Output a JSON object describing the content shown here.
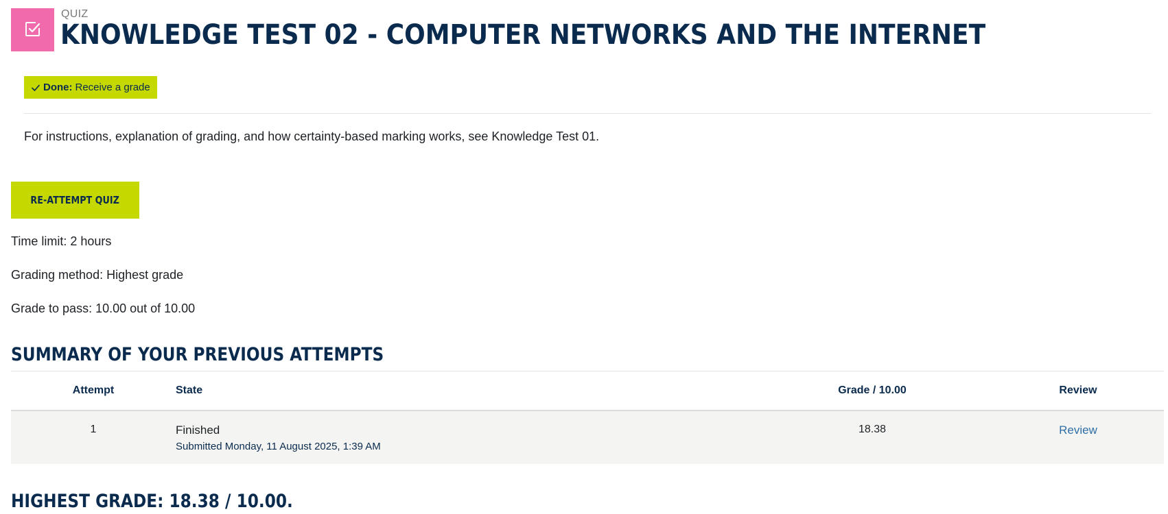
{
  "header": {
    "module_type": "QUIZ",
    "title": "KNOWLEDGE TEST 02 - COMPUTER NETWORKS AND THE INTERNET",
    "icon": "quiz-checkbox-icon",
    "icon_bg_color": "#f06aac"
  },
  "completion": {
    "status_label": "Done:",
    "requirement": "Receive a grade",
    "badge_color": "#c5d800"
  },
  "intro": "For instructions, explanation of grading, and how certainty-based marking works, see Knowledge Test 01.",
  "actions": {
    "reattempt_label": "RE-ATTEMPT QUIZ"
  },
  "quiz_info": {
    "time_limit": "Time limit: 2 hours",
    "grading_method": "Grading method: Highest grade",
    "grade_to_pass": "Grade to pass: 10.00 out of 10.00"
  },
  "summary": {
    "heading": "SUMMARY OF YOUR PREVIOUS ATTEMPTS",
    "columns": [
      "Attempt",
      "State",
      "Grade / 10.00",
      "Review"
    ],
    "rows": [
      {
        "attempt": "1",
        "state": "Finished",
        "submitted": "Submitted Monday, 11 August 2025, 1:39 AM",
        "grade": "18.38",
        "review": "Review"
      }
    ]
  },
  "highest_grade": "HIGHEST GRADE: 18.38 / 10.00.",
  "colors": {
    "heading_navy": "#0a2b4e",
    "accent_lime": "#c5d800",
    "link_blue": "#2f6ea5",
    "row_bg": "#f4f4f2"
  }
}
